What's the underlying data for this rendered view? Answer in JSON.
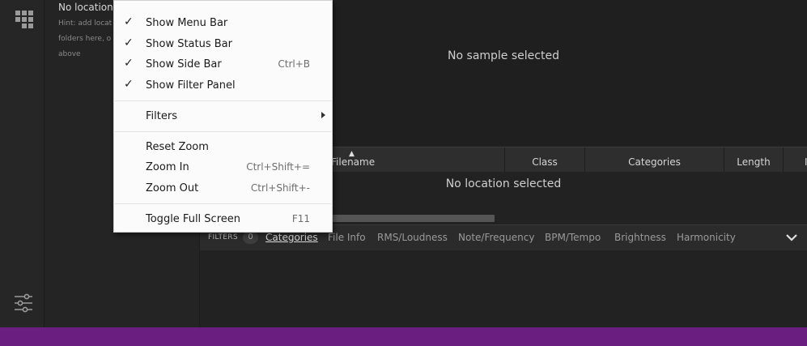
{
  "locations": {
    "title": "No locations",
    "hint_lines": [
      "Hint: add locat",
      "folders here, o",
      "above"
    ]
  },
  "waveform": {
    "empty_text": "No sample selected"
  },
  "table": {
    "columns": [
      "Filename",
      "Class",
      "Categories",
      "Length",
      "I"
    ],
    "empty_text": "No location selected"
  },
  "filters": {
    "label": "FILTERS",
    "count": "0",
    "tabs": [
      "Categories",
      "File Info",
      "RMS/Loudness",
      "Note/Frequency",
      "BPM/Tempo",
      "Brightness",
      "Harmonicity"
    ],
    "active_tab": "Categories"
  },
  "menu": {
    "items": [
      {
        "label": "Show Menu Bar",
        "checked": true,
        "shortcut": ""
      },
      {
        "label": "Show Status Bar",
        "checked": true,
        "shortcut": ""
      },
      {
        "label": "Show Side Bar",
        "checked": true,
        "shortcut": "Ctrl+B"
      },
      {
        "label": "Show Filter Panel",
        "checked": true,
        "shortcut": ""
      },
      {
        "label": "Filters",
        "checked": false,
        "shortcut": ""
      },
      {
        "label": "Reset Zoom",
        "checked": false,
        "shortcut": ""
      },
      {
        "label": "Zoom In",
        "checked": false,
        "shortcut": "Ctrl+Shift+="
      },
      {
        "label": "Zoom Out",
        "checked": false,
        "shortcut": "Ctrl+Shift+-"
      },
      {
        "label": "Toggle Full Screen",
        "checked": false,
        "shortcut": "F11"
      }
    ],
    "check_glyph": "✓"
  },
  "colors": {
    "status_bar": "#6a1e80",
    "background": "#222222",
    "menu_background": "#fbfbfb"
  },
  "icons": {
    "rail_top": "grid-icon",
    "rail_bottom": "sliders-icon",
    "filter_collapse": "chevron-down-icon",
    "sort": "sort-ascending-icon",
    "submenu": "submenu-arrow-icon"
  }
}
